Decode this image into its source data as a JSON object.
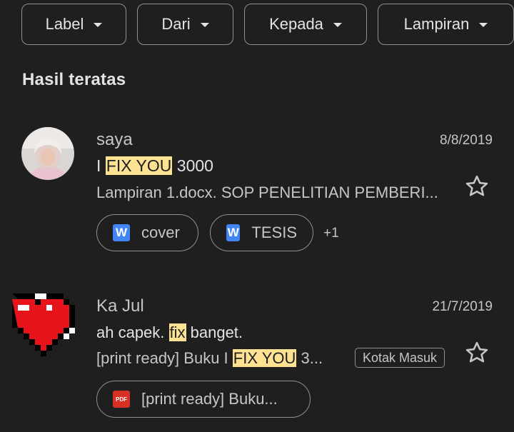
{
  "filters": [
    {
      "label": "Label"
    },
    {
      "label": "Dari"
    },
    {
      "label": "Kepada"
    },
    {
      "label": "Lampiran"
    }
  ],
  "section_title": "Hasil teratas",
  "messages": [
    {
      "sender": "saya",
      "date": "8/8/2019",
      "subject_pre": "I ",
      "subject_hl": "FIX YOU",
      "subject_post": " 3000",
      "snippet": "Lampiran 1.docx. SOP PENELITIAN PEMBERI...",
      "attachments": [
        {
          "name": "cover",
          "icon": "word-icon",
          "icon_text": "W"
        },
        {
          "name": "TESIS",
          "icon": "word-icon",
          "icon_text": "W"
        }
      ],
      "more": "+1"
    },
    {
      "sender": "Ka Jul",
      "date": "21/7/2019",
      "subject_pre": "ah capek. ",
      "subject_hl": "fix",
      "subject_post": " banget.",
      "snippet_pre": "[print ready] Buku I ",
      "snippet_hl": "FIX YOU",
      "snippet_post": " 3...",
      "label": "Kotak Masuk",
      "attachments": [
        {
          "name": "[print ready] Buku...",
          "icon": "pdf-icon",
          "icon_text": "PDF"
        }
      ]
    }
  ],
  "colors": {
    "background": "#1f1f1f",
    "highlight": "#fde293",
    "word": "#4285f4",
    "pdf": "#d93025",
    "heart": "#e8141b"
  }
}
